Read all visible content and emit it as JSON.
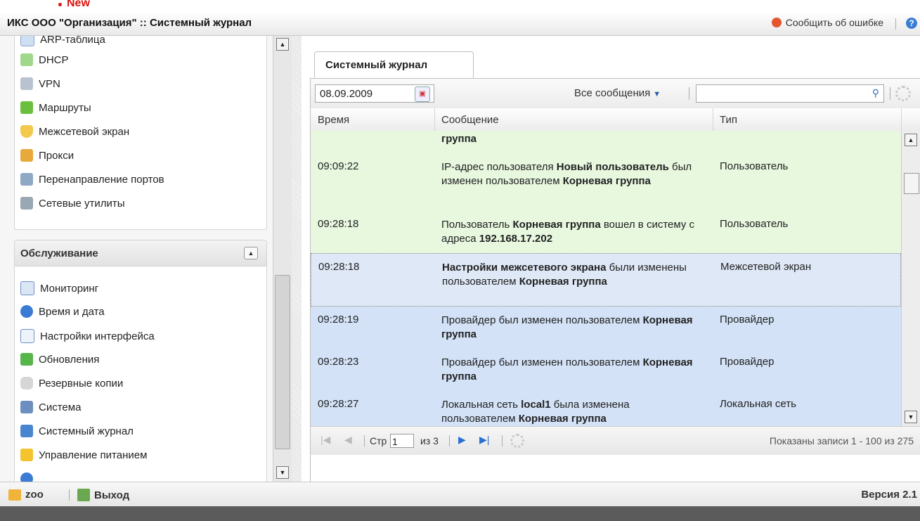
{
  "header": {
    "new_label": "New",
    "title": "ИКС ООО \"Организация\" :: Системный журнал",
    "report_label": "Сообщить об ошибке"
  },
  "sidebar": {
    "network_items": [
      {
        "label": "ARP-таблица",
        "icon": "table-icon"
      },
      {
        "label": "DHCP",
        "icon": "dhcp-icon"
      },
      {
        "label": "VPN",
        "icon": "vpn-icon"
      },
      {
        "label": "Маршруты",
        "icon": "routes-icon"
      },
      {
        "label": "Межсетевой экран",
        "icon": "firewall-icon"
      },
      {
        "label": "Прокси",
        "icon": "proxy-icon"
      },
      {
        "label": "Перенаправление портов",
        "icon": "port-forward-icon"
      },
      {
        "label": "Сетевые утилиты",
        "icon": "wrench-icon"
      }
    ],
    "maintenance": {
      "title": "Обслуживание",
      "items": [
        {
          "label": "Мониторинг",
          "icon": "monitoring-icon"
        },
        {
          "label": "Время и дата",
          "icon": "clock-icon"
        },
        {
          "label": "Настройки интерфейса",
          "icon": "interface-icon"
        },
        {
          "label": "Обновления",
          "icon": "update-icon"
        },
        {
          "label": "Резервные копии",
          "icon": "backup-icon"
        },
        {
          "label": "Система",
          "icon": "system-icon"
        },
        {
          "label": "Системный журнал",
          "icon": "book-icon"
        },
        {
          "label": "Управление питанием",
          "icon": "power-icon"
        }
      ]
    }
  },
  "main": {
    "tab_label": "Системный журнал",
    "date_value": "08.09.2009",
    "filter_label": "Все сообщения",
    "search_value": "",
    "columns": {
      "time": "Время",
      "message": "Сообщение",
      "type": "Тип"
    },
    "rows": [
      {
        "time": "",
        "msg_parts": [
          [
            "b",
            "группа"
          ]
        ],
        "type": ""
      },
      {
        "time": "09:09:22",
        "msg_parts": [
          [
            "",
            "IP-адрес пользователя "
          ],
          [
            "b",
            "Новый пользователь"
          ],
          [
            "",
            " был изменен пользователем "
          ],
          [
            "b",
            "Корневая группа"
          ]
        ],
        "type": "Пользователь"
      },
      {
        "time": "09:28:18",
        "msg_parts": [
          [
            "",
            "Пользователь "
          ],
          [
            "b",
            "Корневая группа"
          ],
          [
            "",
            " вошел в систему с адреса "
          ],
          [
            "b",
            "192.168.17.202"
          ]
        ],
        "type": "Пользователь"
      },
      {
        "time": "09:28:18",
        "msg_parts": [
          [
            "b",
            "Настройки межсетевого экрана"
          ],
          [
            "",
            " были изменены пользователем "
          ],
          [
            "b",
            "Корневая группа"
          ]
        ],
        "type": "Межсетевой экран"
      },
      {
        "time": "09:28:19",
        "msg_parts": [
          [
            "",
            "Провайдер был изменен пользователем "
          ],
          [
            "b",
            "Корневая группа"
          ]
        ],
        "type": "Провайдер"
      },
      {
        "time": "09:28:23",
        "msg_parts": [
          [
            "",
            "Провайдер был изменен пользователем "
          ],
          [
            "b",
            "Корневая группа"
          ]
        ],
        "type": "Провайдер"
      },
      {
        "time": "09:28:27",
        "msg_parts": [
          [
            "",
            "Локальная сеть "
          ],
          [
            "b",
            "local1"
          ],
          [
            "",
            " была изменена пользователем "
          ],
          [
            "b",
            "Корневая группа"
          ]
        ],
        "type": "Локальная сеть"
      }
    ],
    "pager": {
      "page_label": "Стр",
      "page_value": "1",
      "of_label": "из 3",
      "info": "Показаны записи 1 - 100 из 275"
    }
  },
  "footer": {
    "user": "zoo",
    "logout": "Выход",
    "version": "Версия 2.1"
  },
  "colors": {
    "green_row": "#e7f8df",
    "blue_row": "#d3e2f7",
    "accent": "#2a6fd1"
  }
}
